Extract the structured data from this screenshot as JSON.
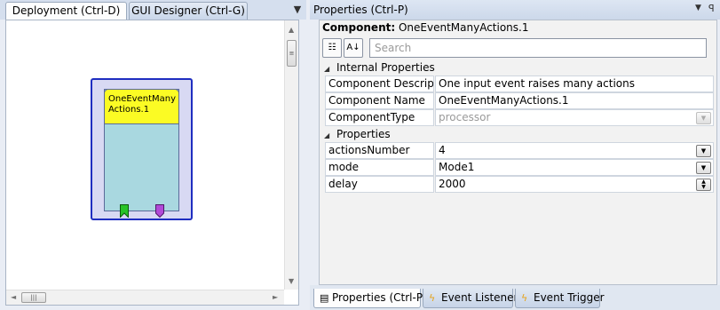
{
  "left_pane": {
    "tabs": [
      {
        "label": "Deployment (Ctrl-D)",
        "active": true
      },
      {
        "label": "GUI Designer (Ctrl-G)",
        "active": false
      }
    ],
    "menu_icon": "▼",
    "component": {
      "label": "OneEventManyActions.1",
      "title_color": "#fbfb24",
      "body_color": "#a9d8e0",
      "border_color": "#1f2ec0",
      "ports": [
        {
          "type": "event-in",
          "color": "#27c427"
        },
        {
          "type": "event-out",
          "color": "#b14ad8"
        }
      ]
    }
  },
  "right_pane": {
    "title": "Properties (Ctrl-P)",
    "component_label": "Component:",
    "component_value": "OneEventManyActions.1",
    "search_placeholder": "Search",
    "sections": [
      {
        "title": "Internal Properties",
        "rows": [
          {
            "key": "Component Descriptio",
            "value": "One input event raises many actions",
            "button": false
          },
          {
            "key": "Component Name",
            "value": "OneEventManyActions.1",
            "button": false
          },
          {
            "key": "ComponentType",
            "value": "processor",
            "button": "dropdown-disabled"
          }
        ]
      },
      {
        "title": "Properties",
        "rows": [
          {
            "key": "actionsNumber",
            "value": "4",
            "button": "dropdown"
          },
          {
            "key": "mode",
            "value": "Mode1",
            "button": "dropdown"
          },
          {
            "key": "delay",
            "value": "2000",
            "button": "spinner"
          }
        ]
      }
    ],
    "bottom_tabs": [
      {
        "label": "Properties (Ctrl-P)",
        "icon": "properties-icon",
        "active": true
      },
      {
        "label": "Event Listener",
        "icon": "lightning-icon",
        "active": false
      },
      {
        "label": "Event Trigger",
        "icon": "lightning-icon",
        "active": false
      }
    ]
  }
}
